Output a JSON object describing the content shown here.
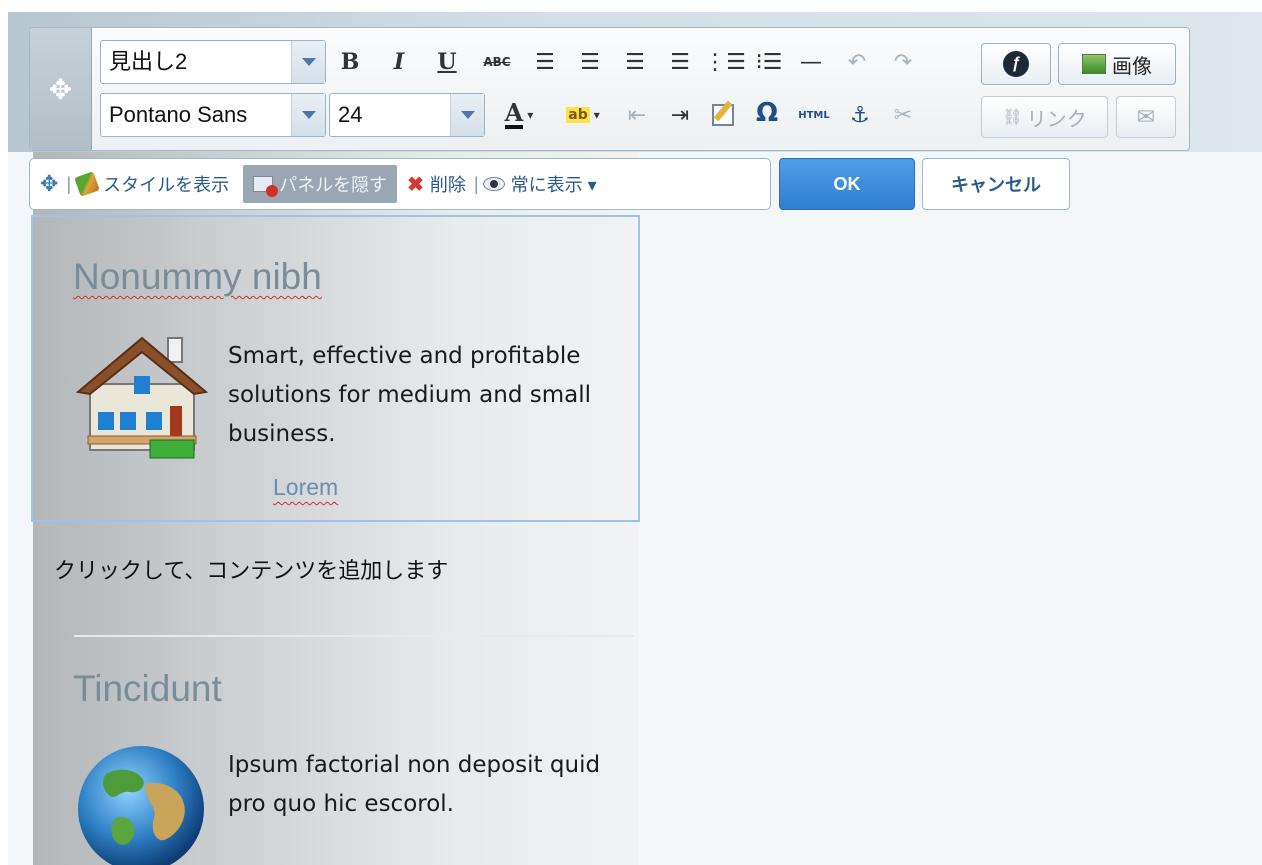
{
  "toolbar": {
    "format_value": "見出し2",
    "font_value": "Pontano Sans",
    "size_value": "24",
    "bold": "B",
    "italic": "I",
    "underline": "U",
    "strike": "ABC",
    "html": "HTML",
    "omega": "Ω",
    "image_label": "画像",
    "link_label": "リンク",
    "hr": "—"
  },
  "panel_bar": {
    "show_styles": "スタイルを表示",
    "hide_panel": "パネルを隠す",
    "delete": "削除",
    "always_show": "常に表示 ▾",
    "ok": "OK",
    "cancel": "キャンセル"
  },
  "content": {
    "block1": {
      "heading": "Nonummy nibh",
      "text_line1": "Smart, effective and profitable",
      "text_line2": "solutions for medium and small",
      "text_line3": "business.",
      "link": "Lorem"
    },
    "click_hint": "クリックして、コンテンツを追加します",
    "block2": {
      "heading": "Tincidunt",
      "text_line1": "Ipsum factorial non deposit quid",
      "text_line2": "pro quo hic escorol."
    }
  },
  "icons": [
    "move-icon",
    "house-icon",
    "globe-icon",
    "brush-icon",
    "delete-icon",
    "eye-icon",
    "flash-icon",
    "anchor-icon"
  ]
}
